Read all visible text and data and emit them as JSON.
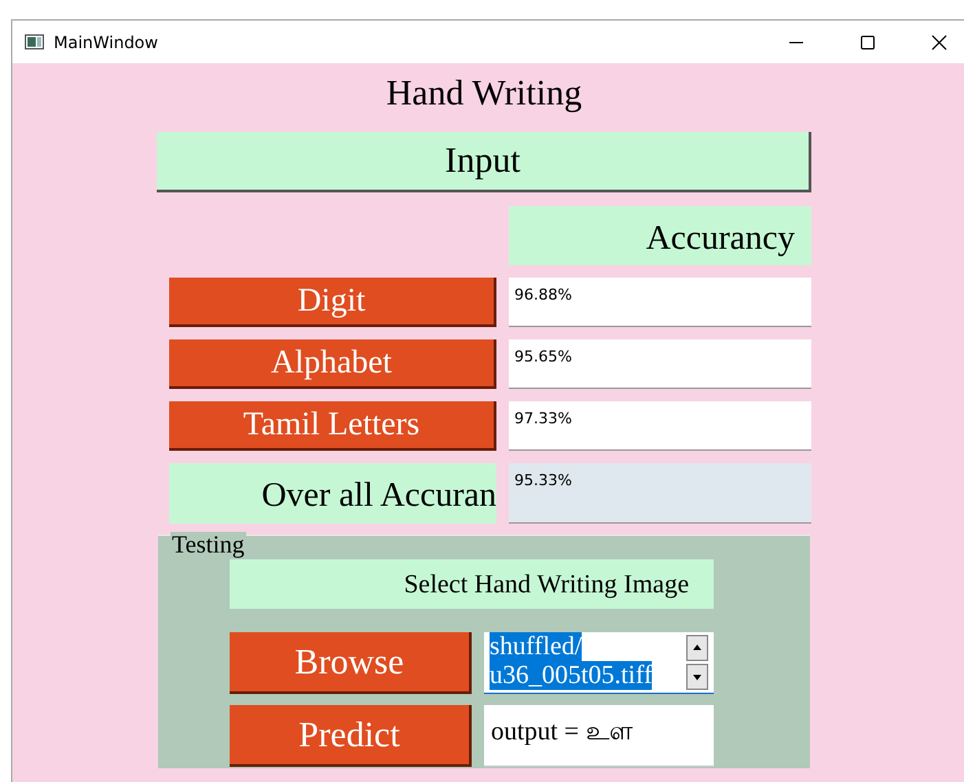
{
  "window": {
    "title": "MainWindow"
  },
  "heading": "Hand Writing",
  "input_button": "Input",
  "accuracy_header": "Accurancy",
  "models": [
    {
      "label": "Digit",
      "accuracy": "96.88%"
    },
    {
      "label": "Alphabet",
      "accuracy": "95.65%"
    },
    {
      "label": "Tamil Letters",
      "accuracy": "97.33%"
    }
  ],
  "overall": {
    "label": "Over all Accuran",
    "accuracy": "95.33%"
  },
  "testing": {
    "title": "Testing",
    "select_label": "Select Hand Writing Image",
    "browse_button": "Browse",
    "path_field": {
      "lines": [
        "shuffled/",
        "u36_005t05.tiff"
      ],
      "text_selected": true
    },
    "predict_button": "Predict",
    "output": "output =  உள"
  }
}
